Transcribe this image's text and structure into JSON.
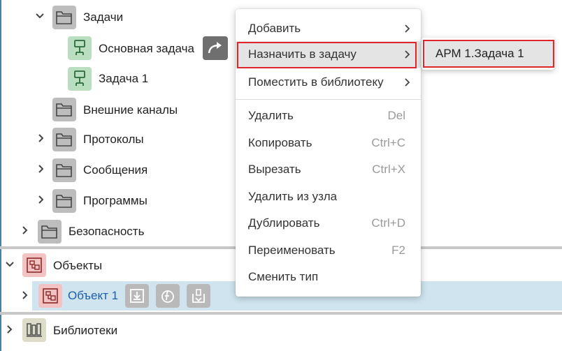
{
  "tree": {
    "zadachi": "Задачи",
    "osnovnaya": "Основная задача",
    "zadacha1": "Задача 1",
    "vneshnie": "Внешние каналы",
    "protokoly": "Протоколы",
    "soobshcheniya": "Сообщения",
    "programmy": "Программы",
    "bezopasnost": "Безопасность",
    "obekty": "Объекты",
    "obekt1": "Объект 1",
    "biblioteki": "Библиотеки"
  },
  "menu": {
    "items": [
      {
        "label": "Добавить",
        "shortcut": ""
      },
      {
        "label": "Назначить в задачу",
        "shortcut": ""
      },
      {
        "label": "Поместить в библиотеку",
        "shortcut": ""
      },
      {
        "label": "Удалить",
        "shortcut": "Del"
      },
      {
        "label": "Копировать",
        "shortcut": "Ctrl+C"
      },
      {
        "label": "Вырезать",
        "shortcut": "Ctrl+X"
      },
      {
        "label": "Удалить из узла",
        "shortcut": ""
      },
      {
        "label": "Дублировать",
        "shortcut": "Ctrl+D"
      },
      {
        "label": "Переименовать",
        "shortcut": "F2"
      },
      {
        "label": "Сменить тип",
        "shortcut": ""
      }
    ]
  },
  "submenu": {
    "items": [
      {
        "label": "АРМ 1.Задача 1"
      }
    ]
  },
  "colors": {
    "highlight_border": "#e0262a",
    "selected_row": "#cfe4ee",
    "object_link": "#1a5fa8"
  },
  "icons": {
    "folder": "folder-icon",
    "task": "task-icon",
    "assign": "assign-arrow-icon",
    "object": "object-icon",
    "library": "library-icon"
  }
}
